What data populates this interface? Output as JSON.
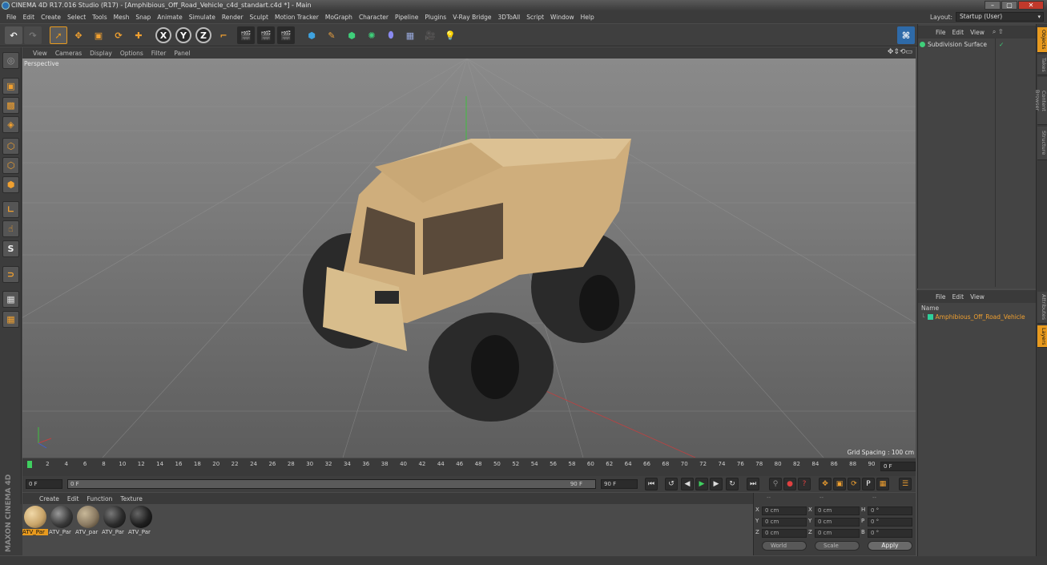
{
  "window": {
    "title": "CINEMA 4D R17.016 Studio (R17) - [Amphibious_Off_Road_Vehicle_c4d_standart.c4d *] - Main",
    "buttons": [
      "–",
      "▢",
      "✕"
    ]
  },
  "menubar": {
    "items": [
      "File",
      "Edit",
      "Create",
      "Select",
      "Tools",
      "Mesh",
      "Snap",
      "Animate",
      "Simulate",
      "Render",
      "Sculpt",
      "Motion Tracker",
      "MoGraph",
      "Character",
      "Pipeline",
      "Plugins",
      "V-Ray Bridge",
      "3DToAll",
      "Script",
      "Window",
      "Help"
    ],
    "layout_label": "Layout:",
    "layout_value": "Startup (User)"
  },
  "toolbar": {
    "axis_labels": [
      "X",
      "Y",
      "Z"
    ]
  },
  "viewport": {
    "menu": [
      "View",
      "Cameras",
      "Display",
      "Options",
      "Filter",
      "Panel"
    ],
    "camera_label": "Perspective",
    "grid_spacing": "Grid Spacing : 100 cm"
  },
  "timeline": {
    "ticks": [
      "0",
      "2",
      "4",
      "6",
      "8",
      "10",
      "12",
      "14",
      "16",
      "18",
      "20",
      "22",
      "24",
      "26",
      "28",
      "30",
      "32",
      "34",
      "36",
      "38",
      "40",
      "42",
      "44",
      "46",
      "48",
      "50",
      "52",
      "54",
      "56",
      "58",
      "60",
      "62",
      "64",
      "66",
      "68",
      "70",
      "72",
      "74",
      "76",
      "78",
      "80",
      "82",
      "84",
      "86",
      "88",
      "90"
    ],
    "current_frame": "0 F"
  },
  "playback": {
    "start_field": "0 F",
    "slider_start": "0 F",
    "slider_end": "90 F",
    "end_field": "90 F"
  },
  "materials": {
    "menu": [
      "Create",
      "Edit",
      "Function",
      "Texture"
    ],
    "items": [
      {
        "label": "ATV_Par",
        "color": "#c9a56a",
        "selected": true
      },
      {
        "label": "ATV_Par",
        "color": "#3a3a3a",
        "selected": false
      },
      {
        "label": "ATV_par",
        "color": "#8a7a62",
        "selected": false
      },
      {
        "label": "ATV_Par",
        "color": "#2b2b2b",
        "selected": false
      },
      {
        "label": "ATV_Par",
        "color": "#1f1f1f",
        "selected": false
      }
    ],
    "brand": "MAXON CINEMA 4D"
  },
  "coordinates": {
    "header": [
      "--",
      "--",
      "--"
    ],
    "rows": [
      {
        "a": "X",
        "a_val": "0 cm",
        "b": "X",
        "b_val": "0 cm",
        "c": "H",
        "c_val": "0 °"
      },
      {
        "a": "Y",
        "a_val": "0 cm",
        "b": "Y",
        "b_val": "0 cm",
        "c": "P",
        "c_val": "0 °"
      },
      {
        "a": "Z",
        "a_val": "0 cm",
        "b": "Z",
        "b_val": "0 cm",
        "c": "B",
        "c_val": "0 °"
      }
    ],
    "mode": "World",
    "scale": "Scale",
    "apply": "Apply"
  },
  "objects_panel": {
    "menu": [
      "File",
      "Edit",
      "View"
    ],
    "object_name": "Subdivision Surface"
  },
  "layers_panel": {
    "menu": [
      "File",
      "Edit",
      "View"
    ],
    "column": "Name",
    "layer_name": "Amphibious_Off_Road_Vehicle",
    "layer_color": "#2fcf9a"
  },
  "side_tabs": {
    "top": [
      "Objects",
      "Takes",
      "Content Browser",
      "Structure"
    ],
    "bottom": [
      "Attributes",
      "Layers"
    ]
  },
  "colors": {
    "accent": "#e89a1e",
    "vehicle_body": "#d6b98a",
    "tire": "#2a2a2a"
  }
}
